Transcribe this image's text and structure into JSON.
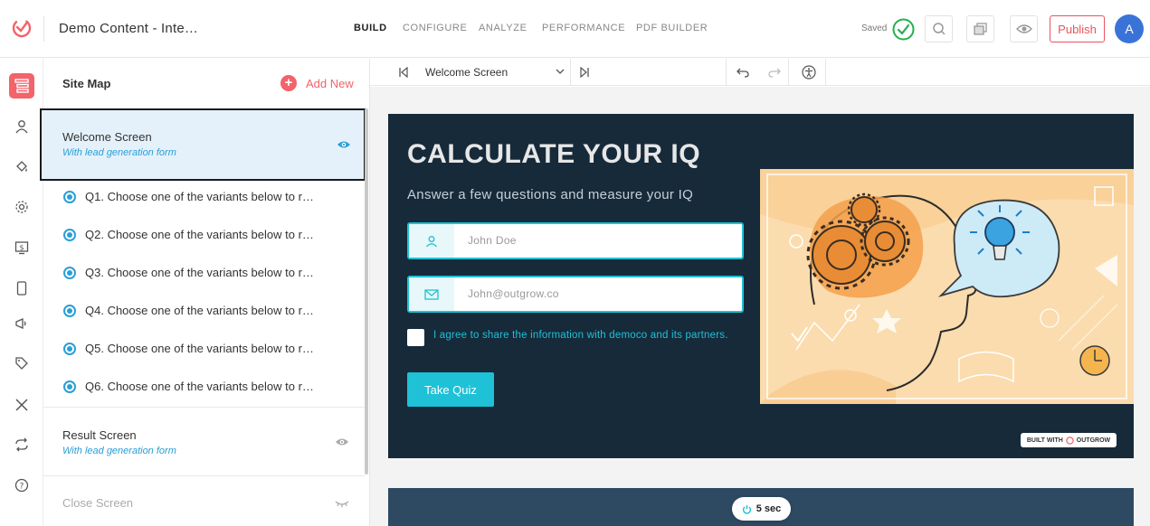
{
  "app": {
    "title": "Demo Content - Inte…",
    "saved_label": "Saved",
    "publish_label": "Publish",
    "avatar_initial": "A",
    "accent": "#f2636a",
    "brand_teal": "#1ec1d6"
  },
  "nav": {
    "tabs": [
      {
        "label": "BUILD",
        "active": true
      },
      {
        "label": "CONFIGURE",
        "active": false
      },
      {
        "label": "ANALYZE",
        "active": false
      },
      {
        "label": "PERFORMANCE",
        "active": false
      },
      {
        "label": "PDF BUILDER",
        "active": false
      }
    ]
  },
  "rail": {
    "icons": [
      "sitemap-icon",
      "user-icon",
      "paint-bucket-icon",
      "gear-icon",
      "dollar-screen-icon",
      "mobile-icon",
      "megaphone-icon",
      "tag-icon",
      "tools-icon",
      "sync-icon",
      "help-icon"
    ]
  },
  "sitemap": {
    "title": "Site Map",
    "add_new_label": "Add New",
    "welcome": {
      "name": "Welcome Screen",
      "sub": "With lead generation form"
    },
    "questions": [
      "Q1. Choose one of the variants below to r…",
      "Q2. Choose one of the variants below to r…",
      "Q3. Choose one of the variants below to r…",
      "Q4. Choose one of the variants below to r…",
      "Q5. Choose one of the variants below to r…",
      "Q6. Choose one of the variants below to r…"
    ],
    "result": {
      "name": "Result Screen",
      "sub": "With lead generation form"
    },
    "close_screen": "Close Screen"
  },
  "editor": {
    "current_screen": "Welcome Screen"
  },
  "card": {
    "title": "CALCULATE YOUR IQ",
    "subtitle": "Answer a few questions and measure your IQ",
    "name_placeholder": "John Doe",
    "email_placeholder": "John@outgrow.co",
    "agree_text": "I agree to share the information with democo and its partners.",
    "cta_label": "Take Quiz",
    "built_with": "BUILT WITH",
    "built_brand": "OUTGROW",
    "background": "#162a3a"
  },
  "timer": {
    "label": "5 sec"
  }
}
